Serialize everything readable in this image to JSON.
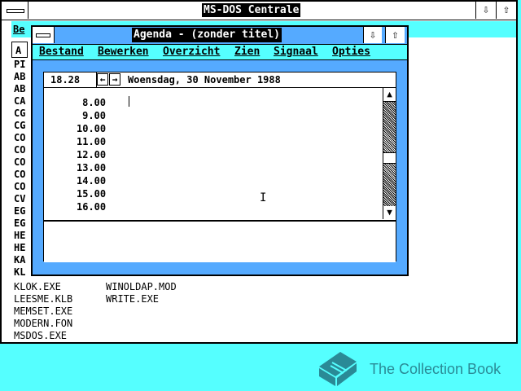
{
  "msdos": {
    "title": "MS-DOS Centrale",
    "menu_visible": "Be",
    "path_box": "A",
    "files_col1_partial": [
      "PI",
      "AB",
      "AB",
      "CA",
      "CG",
      "CG",
      "CO",
      "CO",
      "CO",
      "CO",
      "CO",
      "CV",
      "EG",
      "EG",
      "HE",
      "HE",
      "KA",
      "KL"
    ],
    "files_rows": [
      [
        "KLOK.EXE",
        "WINOLDAP.MOD"
      ],
      [
        "LEESME.KLB",
        "WRITE.EXE"
      ],
      [
        "MEMSET.EXE",
        ""
      ],
      [
        "MODERN.FON",
        ""
      ],
      [
        "MSDOS.EXE",
        ""
      ]
    ]
  },
  "agenda": {
    "title": "Agenda - (zonder titel)",
    "menu": [
      "Bestand",
      "Bewerken",
      "Overzicht",
      "Zien",
      "Signaal",
      "Opties"
    ],
    "current_time": "18.28",
    "date": "Woensdag, 30 November 1988",
    "slots": [
      "8.00",
      "9.00",
      "10.00",
      "11.00",
      "12.00",
      "13.00",
      "14.00",
      "15.00",
      "16.00"
    ],
    "nav_prev": "←",
    "nav_next": "→",
    "scroll_position": 0.55
  },
  "icons": {
    "minimize": "⇩",
    "maximize": "⇧",
    "scroll_up": "▲",
    "scroll_down": "▼",
    "ibeam": "I",
    "book": "book-icon"
  },
  "watermark": {
    "text": "The Collection Book",
    "color": "#2a8a96"
  },
  "colors": {
    "desktop": "#55ffff",
    "agenda_frame": "#55aaff",
    "title_active": "#000000"
  }
}
